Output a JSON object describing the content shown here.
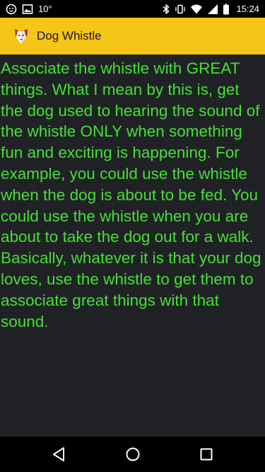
{
  "status_bar": {
    "temperature": "10°",
    "time": "15:24",
    "icons": [
      "notification-icon",
      "image-icon",
      "bluetooth-icon",
      "vibrate-icon",
      "wifi-icon",
      "signal-icon",
      "battery-icon"
    ]
  },
  "app_bar": {
    "title": "Dog Whistle",
    "icon": "dog-icon",
    "background_color": "#f5c518"
  },
  "content": {
    "body": "Associate the whistle with GREAT things. What I mean by this is, get the dog used to hearing the sound of the whistle ONLY when something fun and exciting is happening. For example, you could use the whistle when the dog is about to be fed. You could use the whistle when you are about to take the dog out for a walk. Basically, whatever it is that your dog loves, use the whistle to get them to associate great things with that sound.",
    "text_color": "#44e034"
  },
  "nav_bar": {
    "buttons": [
      "back-icon",
      "home-icon",
      "recents-icon"
    ]
  }
}
